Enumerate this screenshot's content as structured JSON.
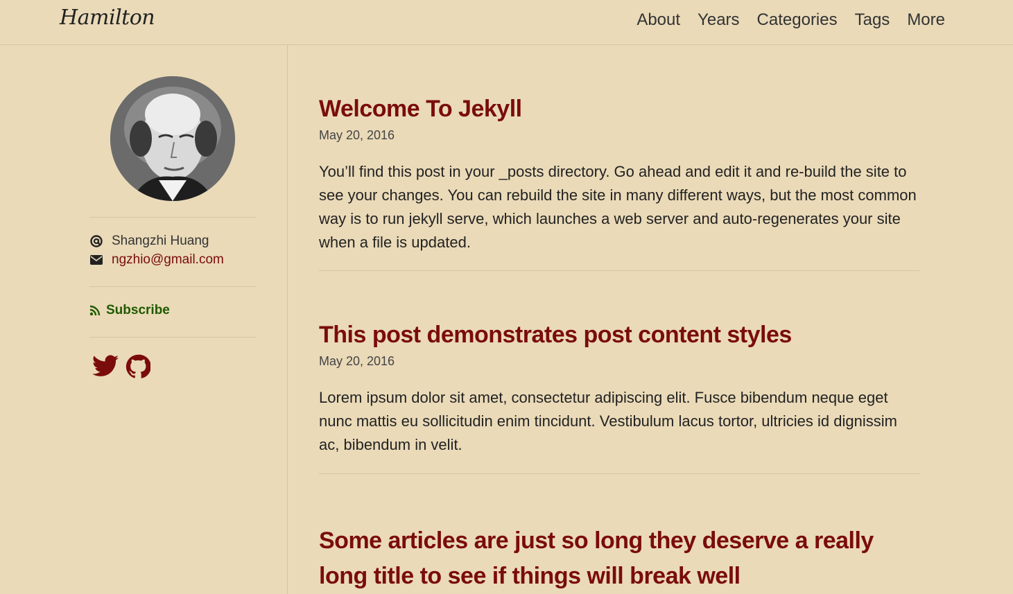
{
  "header": {
    "brand": "Hamilton",
    "nav": [
      "About",
      "Years",
      "Categories",
      "Tags",
      "More"
    ]
  },
  "sidebar": {
    "avatar_alt": "author portrait",
    "author_name": "Shangzhi Huang",
    "email": "ngzhio@gmail.com",
    "subscribe_label": "Subscribe",
    "social_icons": [
      "twitter-icon",
      "github-icon"
    ]
  },
  "posts": [
    {
      "title": "Welcome To Jekyll",
      "date": "May 20, 2016",
      "excerpt": "You’ll find this post in your _posts directory. Go ahead and edit it and re-build the site to see your changes. You can rebuild the site in many different ways, but the most common way is to run jekyll serve, which launches a web server and auto-regenerates your site when a file is updated."
    },
    {
      "title": "This post demonstrates post content styles",
      "date": "May 20, 2016",
      "excerpt": "Lorem ipsum dolor sit amet, consectetur adipiscing elit. Fusce bibendum neque eget nunc mattis eu sollicitudin enim tincidunt. Vestibulum lacus tortor, ultricies id dignissim ac, bibendum in velit."
    },
    {
      "title": "Some articles are just so long they deserve a really long title to see if things will break well"
    }
  ],
  "colors": {
    "background": "#eadab8",
    "accent": "#7a0c0c",
    "subscribe": "#1f5a00",
    "divider": "#d8c59e"
  }
}
